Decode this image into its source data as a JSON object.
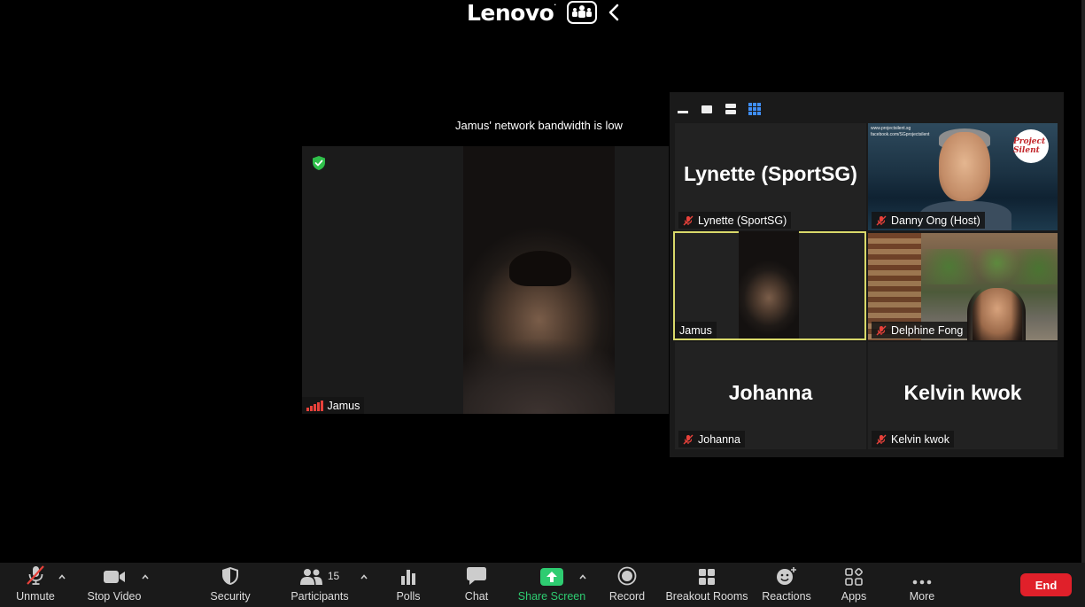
{
  "share_banner": {
    "brand": "Lenovo",
    "brand_mark": "."
  },
  "notice": "Jamus' network bandwidth is low",
  "main_video": {
    "name": "Jamus"
  },
  "gallery": {
    "tiles": [
      {
        "big_name": "Lynette (SportSG)",
        "name": "Lynette (SportSG)",
        "muted": true
      },
      {
        "big_name": "",
        "name": "Danny Ong (Host)",
        "muted": true
      },
      {
        "big_name": "",
        "name": "Jamus",
        "muted": false
      },
      {
        "big_name": "",
        "name": "Delphine Fong",
        "muted": true
      },
      {
        "big_name": "Johanna",
        "name": "Johanna",
        "muted": true
      },
      {
        "big_name": "Kelvin kwok",
        "name": "Kelvin kwok",
        "muted": true
      }
    ],
    "danny_caption": [
      "www.projectsilent.sg",
      "facebook.com/SGprojectsilent"
    ],
    "danny_badge": "Project Silent"
  },
  "toolbar": {
    "unmute": "Unmute",
    "stop_video": "Stop Video",
    "security": "Security",
    "participants": "Participants",
    "participants_count": "15",
    "polls": "Polls",
    "chat": "Chat",
    "share_screen": "Share Screen",
    "record": "Record",
    "breakout_rooms": "Breakout Rooms",
    "reactions": "Reactions",
    "apps": "Apps",
    "more": "More",
    "end": "End"
  },
  "colors": {
    "share_green": "#2ecc71",
    "end_red": "#e0202a",
    "active_speaker_outline": "#d9d96a",
    "mute_red": "#e8413a"
  },
  "icons": [
    "lenovo-logo",
    "share-screen-people-icon",
    "chevron-left-icon",
    "shield-check-icon",
    "signal-bars-icon",
    "muted-mic-icon",
    "video-camera-icon",
    "shield-icon",
    "participants-icon",
    "polls-icon",
    "chat-icon",
    "share-arrow-icon",
    "record-icon",
    "breakout-rooms-icon",
    "reactions-icon",
    "apps-icon",
    "more-dots-icon"
  ]
}
